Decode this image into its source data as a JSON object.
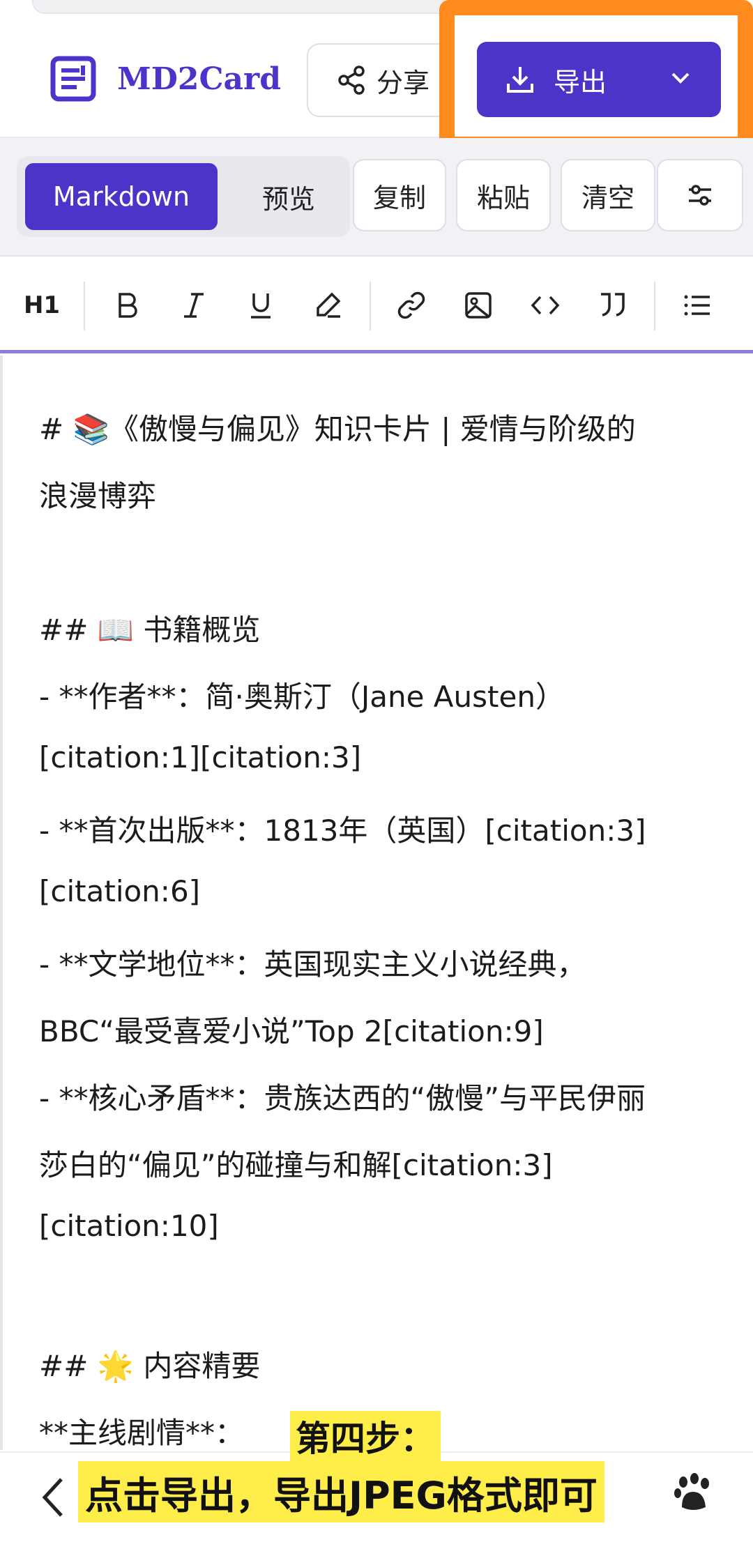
{
  "header": {
    "brand": "MD2Card",
    "share_label": "分享",
    "export_label": "导出"
  },
  "toolbar": {
    "markdown_tab": "Markdown",
    "preview_tab": "预览",
    "copy": "复制",
    "paste": "粘贴",
    "clear": "清空"
  },
  "format_bar": {
    "heading": "H1"
  },
  "editor": {
    "lines": [
      "# 📚《傲慢与偏见》知识卡片 | 爱情与阶级的",
      "浪漫博弈",
      "",
      "## 📖 书籍概览",
      "- **作者**：简·奥斯汀（Jane Austen）",
      "[citation:1][citation:3]",
      "- **首次出版**：1813年（英国）[citation:3]",
      "[citation:6]",
      "- **文学地位**：英国现实主义小说经典，",
      "BBC“最受喜爱小说”Top 2[citation:9]",
      "- **核心矛盾**：贵族达西的“傲慢”与平民伊丽",
      "莎白的“偏见”的碰撞与和解[citation:3]",
      "[citation:10]",
      "",
      "## 🌟 内容精要",
      "**主线剧情**："
    ]
  },
  "overlay": {
    "step_title": "第四步：",
    "step_text": "点击导出，导出JPEG格式即可"
  },
  "colors": {
    "accent": "#4a35c8",
    "highlight_border": "#ff8a1e",
    "caption_bg": "#ffee4a"
  }
}
